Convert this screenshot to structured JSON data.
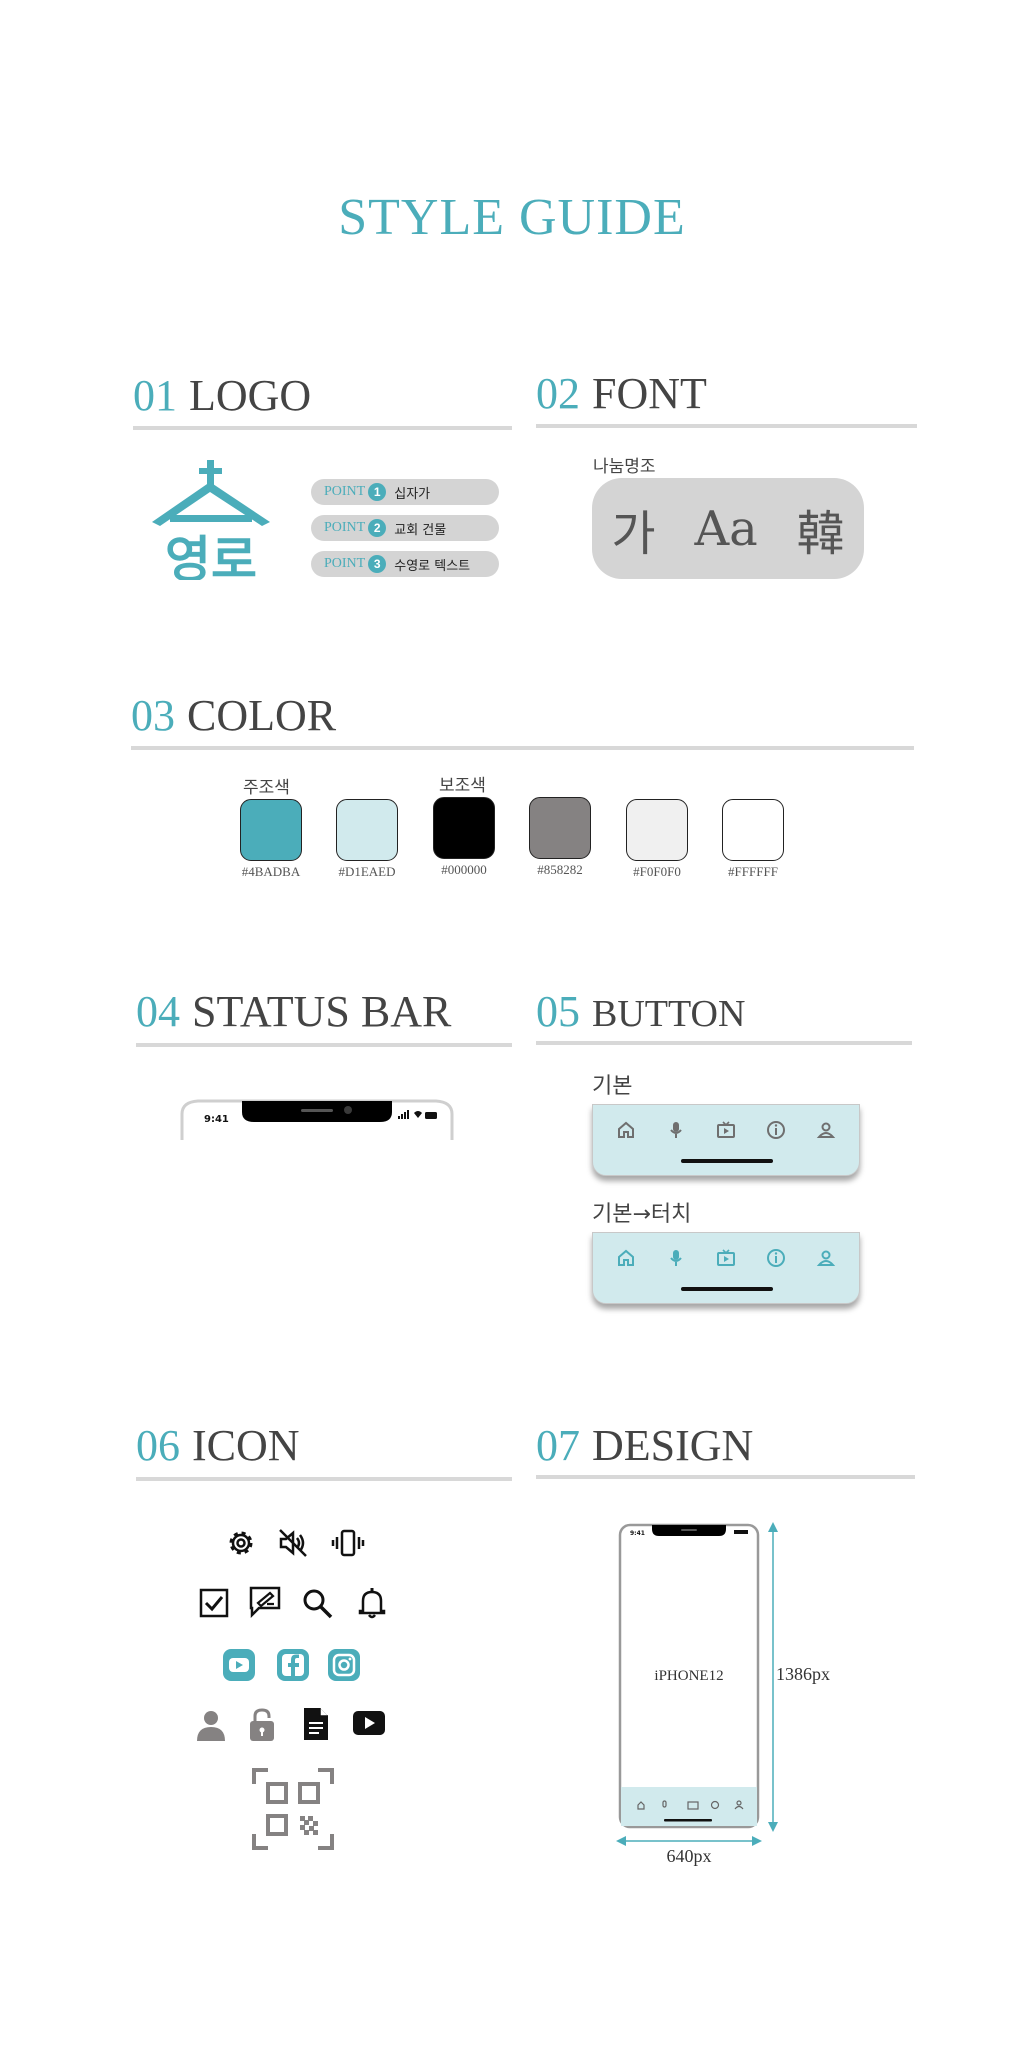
{
  "title": "STYLE GUIDE",
  "sections": {
    "logo": {
      "num": "01",
      "name": "LOGO"
    },
    "font": {
      "num": "02",
      "name": "FONT"
    },
    "color": {
      "num": "03",
      "name": "COLOR"
    },
    "status_bar": {
      "num": "04",
      "name": "STATUS BAR"
    },
    "button": {
      "num": "05",
      "name": "BUTTON"
    },
    "icon": {
      "num": "06",
      "name": "ICON"
    },
    "design": {
      "num": "07",
      "name": "DESIGN"
    }
  },
  "logo": {
    "wordmark": "영로",
    "points": [
      {
        "label": "POINT",
        "n": "1",
        "text": "십자가"
      },
      {
        "label": "POINT",
        "n": "2",
        "text": "교회 건물"
      },
      {
        "label": "POINT",
        "n": "3",
        "text": "수영로 텍스트"
      }
    ]
  },
  "font": {
    "name": "나눔명조",
    "samples": [
      "가",
      "Aa",
      "韓"
    ]
  },
  "color": {
    "primary_label": "주조색",
    "secondary_label": "보조색",
    "swatches": [
      {
        "hex": "#4BADBA",
        "label": "#4BADBA"
      },
      {
        "hex": "#D1EAED",
        "label": "#D1EAED"
      },
      {
        "hex": "#000000",
        "label": "#000000"
      },
      {
        "hex": "#858282",
        "label": "#858282"
      },
      {
        "hex": "#F0F0F0",
        "label": "#F0F0F0"
      },
      {
        "hex": "#FFFFFF",
        "label": "#FFFFFF"
      }
    ]
  },
  "status_bar": {
    "time": "9:41"
  },
  "button": {
    "default_label": "기본",
    "touch_label": "기본→터치",
    "icons": [
      "home-icon",
      "microphone-icon",
      "tv-icon",
      "info-icon",
      "user-icon"
    ]
  },
  "icons": {
    "row1": [
      "gear-icon",
      "mute-icon",
      "vibrate-icon"
    ],
    "row2": [
      "checkbox-icon",
      "note-edit-icon",
      "search-icon",
      "bell-icon"
    ],
    "row3": [
      "youtube-icon",
      "facebook-icon",
      "instagram-icon"
    ],
    "row4": [
      "person-icon",
      "lock-icon",
      "document-icon",
      "play-icon"
    ],
    "row5": [
      "qr-code-icon"
    ]
  },
  "design": {
    "device_label": "iPHONE12",
    "time": "9:41",
    "height_label": "1386px",
    "width_label": "640px"
  },
  "colors": {
    "accent": "#4BADBA",
    "light": "#D1EAED",
    "rule": "#D8D8D8",
    "pill": "#D4D4D4"
  }
}
